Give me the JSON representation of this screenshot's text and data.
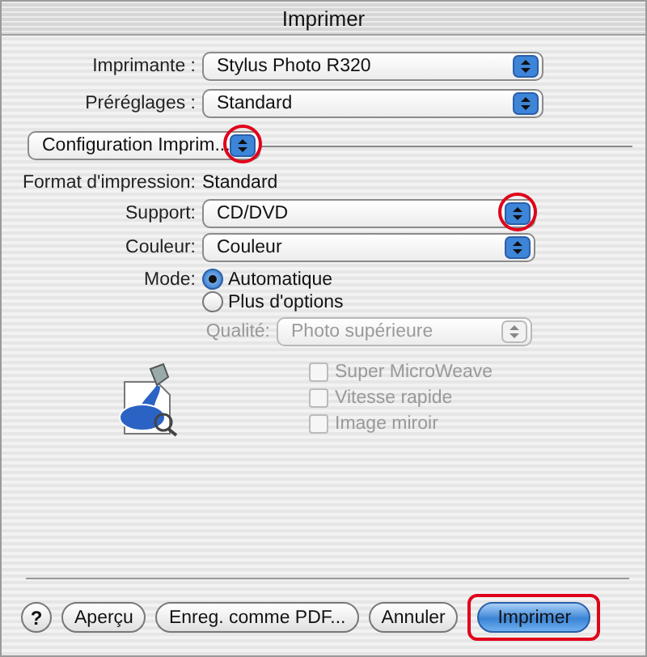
{
  "window": {
    "title": "Imprimer"
  },
  "printer": {
    "label": "Imprimante :",
    "value": "Stylus Photo R320"
  },
  "presets": {
    "label": "Préréglages :",
    "value": "Standard"
  },
  "panel_menu": {
    "value": "Configuration Imprim...",
    "highlighted": true
  },
  "format": {
    "label": "Format d'impression:",
    "value": "Standard"
  },
  "support": {
    "label": "Support:",
    "value": "CD/DVD",
    "highlighted": true
  },
  "color": {
    "label": "Couleur:",
    "value": "Couleur"
  },
  "mode": {
    "label": "Mode:",
    "options": [
      {
        "label": "Automatique",
        "selected": true
      },
      {
        "label": "Plus d'options",
        "selected": false
      }
    ]
  },
  "quality": {
    "label": "Qualité:",
    "value": "Photo supérieure",
    "disabled": true
  },
  "options": [
    {
      "label": "Super MicroWeave",
      "checked": false,
      "disabled": true
    },
    {
      "label": "Vitesse rapide",
      "checked": false,
      "disabled": true
    },
    {
      "label": "Image miroir",
      "checked": false,
      "disabled": true
    }
  ],
  "buttons": [
    {
      "kind": "help",
      "label": "?",
      "highlighted": false
    },
    {
      "kind": "push",
      "label": "Aperçu",
      "highlighted": false
    },
    {
      "kind": "push",
      "label": "Enreg. comme PDF...",
      "highlighted": false
    },
    {
      "kind": "push",
      "label": "Annuler",
      "highlighted": false
    },
    {
      "kind": "default",
      "label": "Imprimer",
      "highlighted": true
    }
  ]
}
